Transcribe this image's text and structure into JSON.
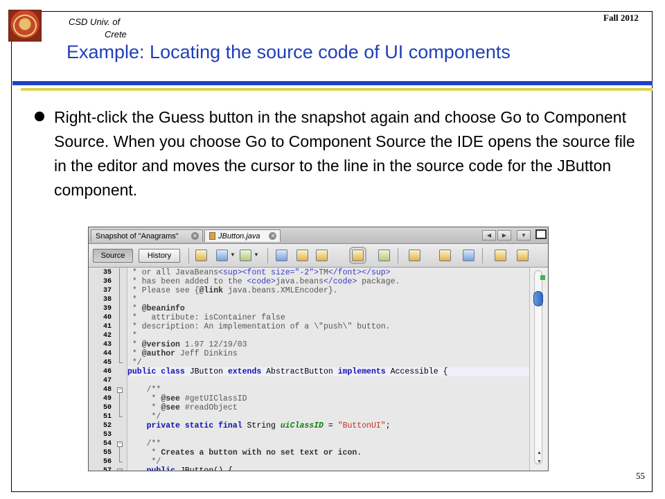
{
  "header": {
    "institution_line1": "CSD Univ. of",
    "institution_line2": "Crete",
    "term": "Fall 2012",
    "title": "Example: Locating the source code of UI components"
  },
  "body": {
    "paragraph": "Right-click the Guess button in the snapshot again and choose Go to Component Source. When you choose Go to Component Source the IDE opens the source file in the editor and moves the cursor to the line in the source code for the JButton component."
  },
  "footer": {
    "page_number": "55"
  },
  "ide": {
    "tabs": [
      {
        "label": "Snapshot of \"Anagrams\"",
        "close": "✕"
      },
      {
        "label": "JButton.java",
        "close": "✕"
      }
    ],
    "nav_buttons": [
      "◀",
      "▶",
      "▼"
    ],
    "toolbar": {
      "source_label": "Source",
      "history_label": "History"
    },
    "icons": [
      "back-icon",
      "previous-edit-icon",
      "next-edit-icon",
      "find-icon",
      "find-previous-icon",
      "find-next-icon",
      "toggle-highlight-icon",
      "toggle-rect-select-icon",
      "previous-bookmark-icon",
      "next-bookmark-icon",
      "toggle-bookmark-icon",
      "shift-left-icon",
      "shift-right-icon"
    ],
    "lines": [
      {
        "n": "35",
        "segs": [
          [
            "cmt",
            " * or all JavaBeans"
          ],
          [
            "tag",
            "<sup><font size=\"-2\">"
          ],
          [
            "cmt",
            "TM"
          ],
          [
            "tag",
            "</font></sup>"
          ]
        ]
      },
      {
        "n": "36",
        "segs": [
          [
            "cmt",
            " * has been added to the "
          ],
          [
            "tag",
            "<code>"
          ],
          [
            "cmt",
            "java.beans"
          ],
          [
            "tag",
            "</code>"
          ],
          [
            "cmt",
            " package."
          ]
        ]
      },
      {
        "n": "37",
        "segs": [
          [
            "cmt",
            " * Please see {"
          ],
          [
            "jd",
            "@link"
          ],
          [
            "cmt",
            " java.beans.XMLEncoder}."
          ]
        ]
      },
      {
        "n": "38",
        "segs": [
          [
            "cmt",
            " *"
          ]
        ]
      },
      {
        "n": "39",
        "segs": [
          [
            "cmt",
            " * "
          ],
          [
            "jd",
            "@beaninfo"
          ]
        ]
      },
      {
        "n": "40",
        "segs": [
          [
            "cmt",
            " *   attribute: isContainer false"
          ]
        ]
      },
      {
        "n": "41",
        "segs": [
          [
            "cmt",
            " * description: An implementation of a \\\"push\\\" button."
          ]
        ]
      },
      {
        "n": "42",
        "segs": [
          [
            "cmt",
            " *"
          ]
        ]
      },
      {
        "n": "43",
        "segs": [
          [
            "cmt",
            " * "
          ],
          [
            "jd",
            "@version"
          ],
          [
            "cmt",
            " 1.97 12/19/03"
          ]
        ]
      },
      {
        "n": "44",
        "segs": [
          [
            "cmt",
            " * "
          ],
          [
            "jd",
            "@author"
          ],
          [
            "cmt",
            " Jeff Dinkins"
          ]
        ]
      },
      {
        "n": "45",
        "segs": [
          [
            "cmt",
            " */"
          ]
        ]
      },
      {
        "n": "46",
        "segs": [
          [
            "kw",
            "public class "
          ],
          [
            "ident",
            "JButton "
          ],
          [
            "kw",
            "extends "
          ],
          [
            "pl",
            "AbstractButton "
          ],
          [
            "kw",
            "implements "
          ],
          [
            "pl",
            "Accessible {"
          ]
        ],
        "current": true
      },
      {
        "n": "47",
        "segs": [
          [
            "pl",
            ""
          ]
        ]
      },
      {
        "n": "48",
        "segs": [
          [
            "cmt",
            "    /**"
          ]
        ]
      },
      {
        "n": "49",
        "segs": [
          [
            "cmt",
            "     * "
          ],
          [
            "jd",
            "@see"
          ],
          [
            "cmt",
            " #getUIClassID"
          ]
        ]
      },
      {
        "n": "50",
        "segs": [
          [
            "cmt",
            "     * "
          ],
          [
            "jd",
            "@see"
          ],
          [
            "cmt",
            " #readObject"
          ]
        ]
      },
      {
        "n": "51",
        "segs": [
          [
            "cmt",
            "     */"
          ]
        ]
      },
      {
        "n": "52",
        "segs": [
          [
            "kw",
            "    private static final "
          ],
          [
            "pl",
            "String "
          ],
          [
            "fld",
            "uiClassID"
          ],
          [
            "pl",
            " = "
          ],
          [
            "str",
            "\"ButtonUI\""
          ],
          [
            "pl",
            ";"
          ]
        ]
      },
      {
        "n": "53",
        "segs": [
          [
            "pl",
            ""
          ]
        ]
      },
      {
        "n": "54",
        "segs": [
          [
            "cmt",
            "    /**"
          ]
        ]
      },
      {
        "n": "55",
        "segs": [
          [
            "cmt",
            "     * "
          ],
          [
            "jd",
            "Creates a button with no set text or icon."
          ]
        ]
      },
      {
        "n": "56",
        "segs": [
          [
            "cmt",
            "     */"
          ]
        ]
      },
      {
        "n": "57",
        "segs": [
          [
            "kw",
            "    public "
          ],
          [
            "ident",
            "JButton"
          ],
          [
            "pl",
            "() {"
          ]
        ]
      }
    ]
  }
}
